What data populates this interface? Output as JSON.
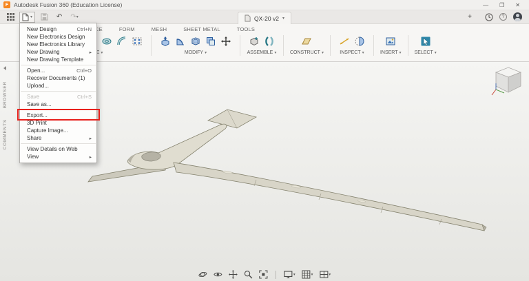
{
  "titlebar": {
    "title": "Autodesk Fusion 360 (Education License)",
    "logo_letter": "F"
  },
  "glyphs": {
    "caret_down": "▾",
    "submenu_arrow": "▸",
    "undo": "↶",
    "redo": "↷",
    "plus": "+",
    "minimize": "—",
    "maximize": "❐",
    "close": "✕",
    "help": "?"
  },
  "appbar": {
    "document_tab": "QX-20 v2"
  },
  "ribbon": {
    "tabs": [
      "SURFACE",
      "FORM",
      "MESH",
      "SHEET METAL",
      "TOOLS"
    ],
    "group_labels": [
      "CREATE",
      "MODIFY",
      "ASSEMBLE",
      "CONSTRUCT",
      "INSPECT",
      "INSERT",
      "SELECT"
    ]
  },
  "file_menu": {
    "items": [
      {
        "label": "New Design",
        "shortcut": "Ctrl+N"
      },
      {
        "label": "New Electronics Design"
      },
      {
        "label": "New Electronics Library"
      },
      {
        "label": "New Drawing",
        "submenu": true
      },
      {
        "label": "New Drawing Template"
      },
      {
        "label": "Open...",
        "shortcut": "Ctrl+O"
      },
      {
        "label": "Recover Documents (1)"
      },
      {
        "label": "Upload..."
      },
      {
        "label": "Save",
        "shortcut": "Ctrl+S",
        "disabled": true
      },
      {
        "label": "Save as..."
      },
      {
        "label": "Export...",
        "annotated": true
      },
      {
        "label": "3D Print"
      },
      {
        "label": "Capture Image..."
      },
      {
        "label": "Share",
        "submenu": true
      },
      {
        "label": "View Details on Web"
      },
      {
        "label": "View",
        "submenu": true
      }
    ]
  },
  "sidebar": {
    "browser": "BROWSER",
    "comments": "COMMENTS"
  },
  "colors": {
    "annotation_red": "#e8211d",
    "logo_orange": "#f6861f"
  }
}
